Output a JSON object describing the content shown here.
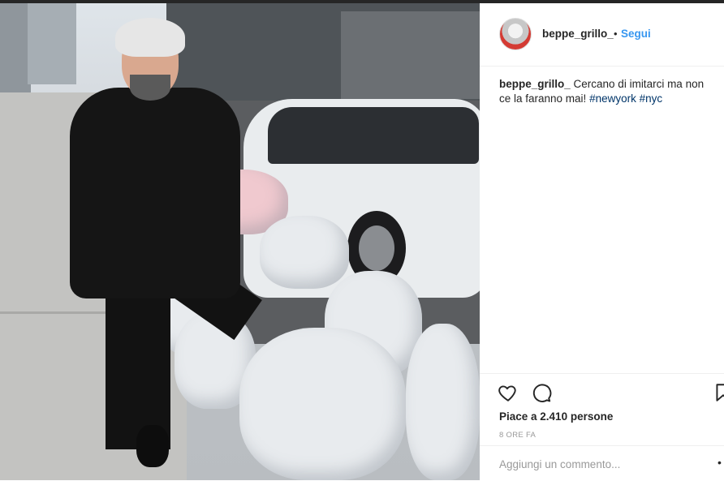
{
  "post": {
    "username": "beppe_grillo_",
    "separator": "•",
    "follow_label": "Segui",
    "caption": {
      "username": "beppe_grillo_",
      "text": " Cercano di imitarci ma non ce la faranno mai! ",
      "hashtags": [
        "#newyork",
        "#nyc"
      ]
    },
    "actions": {
      "like_icon": "heart-icon",
      "comment_icon": "comment-icon",
      "save_icon": "bookmark-icon"
    },
    "likes_text": "Piace a 2.410 persone",
    "time_ago": "8 ORE FA",
    "comment_placeholder": "Aggiungi un commento...",
    "colors": {
      "link": "#3897f0",
      "hashtag": "#003569",
      "text": "#262626",
      "muted": "#999999",
      "avatar_accent": "#d43b33"
    }
  }
}
